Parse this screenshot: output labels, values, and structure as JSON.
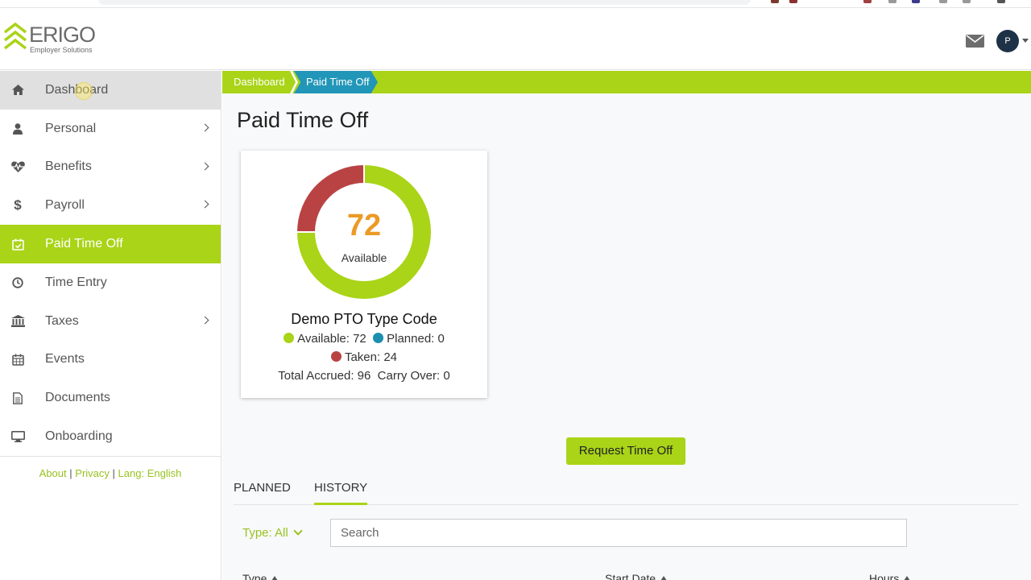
{
  "brand": {
    "name": "ERIGO",
    "tagline": "Employer Solutions",
    "accent": "#a9d417",
    "secondary": "#2196b8"
  },
  "header": {
    "mail_icon": "envelope-icon",
    "avatar_initial": "P"
  },
  "sidebar": {
    "items": [
      {
        "label": "Dashboard",
        "icon": "home-icon",
        "has_children": false
      },
      {
        "label": "Personal",
        "icon": "user-icon",
        "has_children": true
      },
      {
        "label": "Benefits",
        "icon": "heartbeat-icon",
        "has_children": true
      },
      {
        "label": "Payroll",
        "icon": "dollar-icon",
        "has_children": true
      },
      {
        "label": "Paid Time Off",
        "icon": "calendar-check-icon",
        "has_children": false,
        "active": true
      },
      {
        "label": "Time Entry",
        "icon": "clock-icon",
        "has_children": false
      },
      {
        "label": "Taxes",
        "icon": "bank-icon",
        "has_children": true
      },
      {
        "label": "Events",
        "icon": "calendar-icon",
        "has_children": false
      },
      {
        "label": "Documents",
        "icon": "document-icon",
        "has_children": false
      },
      {
        "label": "Onboarding",
        "icon": "monitor-icon",
        "has_children": false
      }
    ],
    "footer": {
      "about": "About",
      "privacy": "Privacy",
      "lang": "Lang: English",
      "sep": "|"
    }
  },
  "breadcrumb": {
    "items": [
      "Dashboard",
      "Paid Time Off"
    ]
  },
  "main": {
    "title": "Paid Time Off",
    "pto_card": {
      "available_value": "72",
      "available_caption": "Available",
      "type_code": "Demo PTO Type Code",
      "legend": {
        "available": "Available: 72",
        "planned": "Planned: 0",
        "taken": "Taken: 24"
      },
      "totals": "Total Accrued: 96  Carry Over: 0",
      "donut": {
        "available": 72,
        "planned": 0,
        "taken": 24,
        "colors": {
          "available": "#a9d417",
          "planned": "#1a8fb0",
          "taken": "#b94343"
        }
      }
    },
    "request_button": "Request Time Off",
    "tabs": [
      "PLANNED",
      "HISTORY"
    ],
    "active_tab": "HISTORY",
    "type_filter": "Type: All",
    "search_placeholder": "Search",
    "columns": [
      "Type",
      "Start Date",
      "Hours"
    ]
  }
}
